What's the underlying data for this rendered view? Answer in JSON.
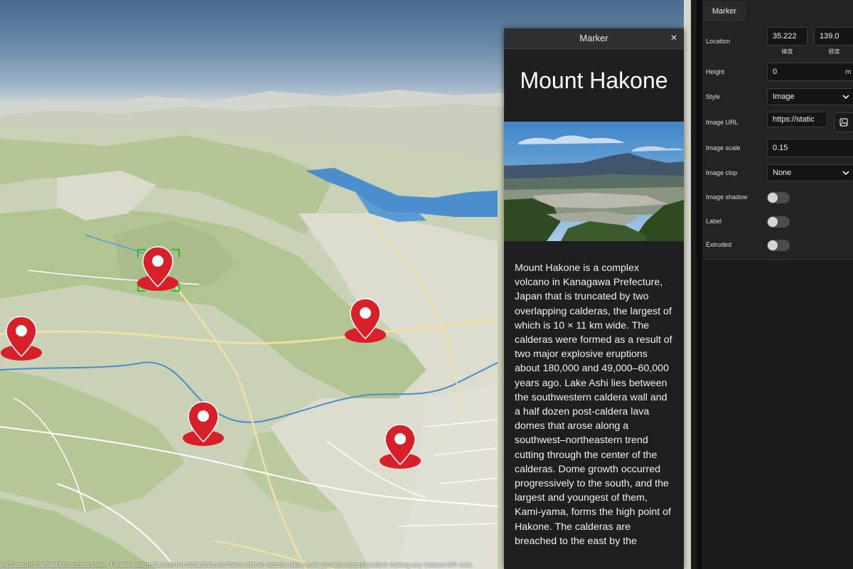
{
  "infobox": {
    "window_title": "Marker",
    "close_glyph": "×",
    "heading": "Mount Hakone",
    "description": "Mount Hakone is a complex volcano in Kanagawa Prefecture, Japan that is truncated by two overlapping calderas, the largest of which is 10 × 11 km wide. The calderas were formed as a result of two major explosive eruptions about 180,000 and 49,000–60,000 years ago. Lake Ashi lies between the southwestern caldera wall and a half dozen post-caldera lava domes that arose along a southwest–northeastern trend cutting through the center of the calderas. Dome growth occurred progressively to the south, and the largest and youngest of them, Kami-yama, forms the high point of Hakone. The calderas are breached to the east by the"
  },
  "panel": {
    "tab_label": "Marker",
    "location": {
      "label": "Location",
      "latitude": "35.222",
      "longitude": "139.0",
      "latitude_caption": "緯度",
      "longitude_caption": "経度"
    },
    "height": {
      "label": "Height",
      "value": "0",
      "unit": "m"
    },
    "style": {
      "label": "Style",
      "selected": "Image"
    },
    "image_url": {
      "label": "Image URL",
      "value": "https://static"
    },
    "image_scale": {
      "label": "Image scale",
      "value": "0.15"
    },
    "image_clip": {
      "label": "Image clop",
      "selected": "None"
    },
    "image_shadow": {
      "label": "Image shadow",
      "on": false
    },
    "label_toggle": {
      "label": "Label",
      "on": false
    },
    "extruded": {
      "label": "Extruded",
      "on": false
    }
  },
  "map": {
    "attribution_prefix": "ing Cesium's default ion access token. Please assign ",
    "attribution_code": "Cesium.Ion.defaultAccessToken",
    "attribution_suffix": " with an access token from your ion account before making any Cesium API calls.",
    "marker_color": "#d8202a",
    "selection_color": "#22c42a"
  },
  "icons": {
    "marker": "map-pin-icon",
    "image_picker": "image-icon",
    "select_caret": "chevron-down-icon",
    "close": "close-icon"
  },
  "colors": {
    "panel_bg": "#1c1c1e",
    "lake": "#4a8fcb",
    "terrain_green": "#b7c79b",
    "terrain_light": "#d9dcd0"
  }
}
